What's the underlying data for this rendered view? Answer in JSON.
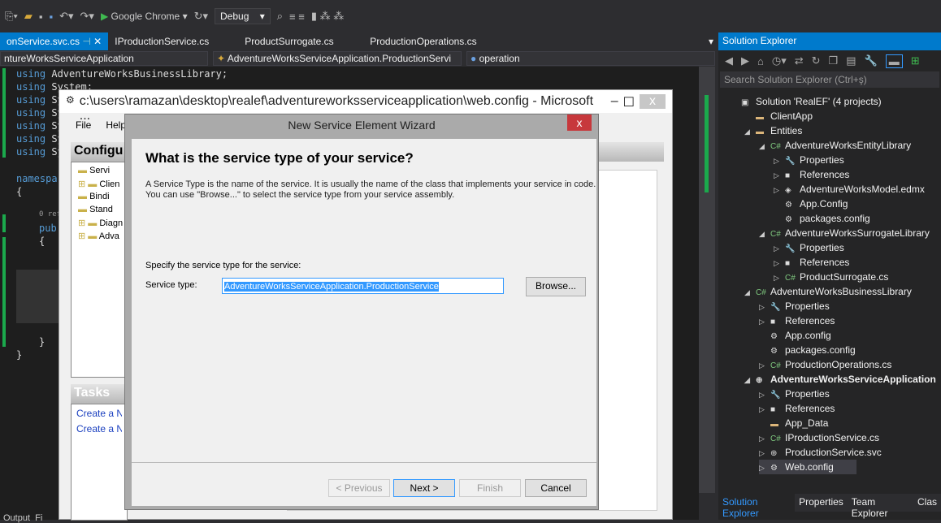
{
  "toolbar": {
    "browser": "Google Chrome",
    "config": "Debug"
  },
  "tabs": [
    "onService.svc.cs",
    "IProductionService.cs",
    "ProductSurrogate.cs",
    "ProductionOperations.cs"
  ],
  "navbar": {
    "project": "ntureWorksServiceApplication",
    "type": "AdventureWorksServiceApplication.ProductionServi",
    "member": "operation"
  },
  "code": {
    "line1_kw": "using",
    "line1": " AdventureWorksBusinessLibrary;",
    "line2": " System;",
    "using": "using",
    "sy": " Sy",
    "namespace": "namespa",
    "brace_open": "{",
    "refs": "0 refe",
    "pub": "pub",
    "inner_open": "{",
    "inner_close": "}",
    "brace_close": "}"
  },
  "solution_explorer": {
    "title": "Solution Explorer",
    "search_placeholder": "Search Solution Explorer (Ctrl+ş)",
    "items": [
      {
        "label": "Solution 'RealEF' (4 projects)",
        "level": 0,
        "arrow": "",
        "icon": "▣"
      },
      {
        "label": "ClientApp",
        "level": 1,
        "arrow": "",
        "icon": "▬"
      },
      {
        "label": "Entities",
        "level": 1,
        "arrow": "◢",
        "icon": "▬"
      },
      {
        "label": "AdventureWorksEntityLibrary",
        "level": 2,
        "arrow": "◢",
        "icon": "C#"
      },
      {
        "label": "Properties",
        "level": 3,
        "arrow": "▷",
        "icon": "🔧"
      },
      {
        "label": "References",
        "level": 3,
        "arrow": "▷",
        "icon": "■"
      },
      {
        "label": "AdventureWorksModel.edmx",
        "level": 3,
        "arrow": "▷",
        "icon": "◈"
      },
      {
        "label": "App.Config",
        "level": 3,
        "arrow": "",
        "icon": "⚙"
      },
      {
        "label": "packages.config",
        "level": 3,
        "arrow": "",
        "icon": "⚙"
      },
      {
        "label": "AdventureWorksSurrogateLibrary",
        "level": 2,
        "arrow": "◢",
        "icon": "C#"
      },
      {
        "label": "Properties",
        "level": 3,
        "arrow": "▷",
        "icon": "🔧"
      },
      {
        "label": "References",
        "level": 3,
        "arrow": "▷",
        "icon": "■"
      },
      {
        "label": "ProductSurrogate.cs",
        "level": 3,
        "arrow": "▷",
        "icon": "C#"
      },
      {
        "label": "AdventureWorksBusinessLibrary",
        "level": 1,
        "arrow": "◢",
        "icon": "C#"
      },
      {
        "label": "Properties",
        "level": 2,
        "arrow": "▷",
        "icon": "🔧"
      },
      {
        "label": "References",
        "level": 2,
        "arrow": "▷",
        "icon": "■"
      },
      {
        "label": "App.config",
        "level": 2,
        "arrow": "",
        "icon": "⚙"
      },
      {
        "label": "packages.config",
        "level": 2,
        "arrow": "",
        "icon": "⚙"
      },
      {
        "label": "ProductionOperations.cs",
        "level": 2,
        "arrow": "▷",
        "icon": "C#"
      },
      {
        "label": "AdventureWorksServiceApplication",
        "level": 1,
        "arrow": "◢",
        "icon": "⊕",
        "bold": true
      },
      {
        "label": "Properties",
        "level": 2,
        "arrow": "▷",
        "icon": "🔧"
      },
      {
        "label": "References",
        "level": 2,
        "arrow": "▷",
        "icon": "■"
      },
      {
        "label": "App_Data",
        "level": 2,
        "arrow": "",
        "icon": "▬"
      },
      {
        "label": "IProductionService.cs",
        "level": 2,
        "arrow": "▷",
        "icon": "C#"
      },
      {
        "label": "ProductionService.svc",
        "level": 2,
        "arrow": "▷",
        "icon": "⊕"
      },
      {
        "label": "Web.config",
        "level": 2,
        "arrow": "▷",
        "icon": "⚙"
      }
    ],
    "bottom_tabs": [
      "Solution Explorer",
      "Properties",
      "Team Explorer",
      "Clas"
    ]
  },
  "config_editor": {
    "title": "c:\\users\\ramazan\\desktop\\realef\\adventureworksserviceapplication\\web.config - Microsoft ...",
    "menu": [
      "File",
      "Help"
    ],
    "config_heading": "Configu",
    "tree": [
      "Servi",
      "Clien",
      "Bindi",
      "Stand",
      "Diagn",
      "Adva"
    ],
    "tasks_heading": "Tasks",
    "tasks": [
      "Create a New",
      "Create a New"
    ]
  },
  "wizard": {
    "title": "New Service Element Wizard",
    "heading": "What is the service type of your service?",
    "desc1": "A Service Type is the name of the service. It is usually the name of the class that implements your service in code.",
    "desc2": "You can use \"Browse...\" to select the service type from your service assembly.",
    "specify": "Specify the service type for the service:",
    "field_label": "Service type:",
    "field_value": "AdventureWorksServiceApplication.ProductionService",
    "browse": "Browse...",
    "previous": "< Previous",
    "next": "Next >",
    "finish": "Finish",
    "cancel": "Cancel"
  },
  "bottom_left": "Output  Fi"
}
